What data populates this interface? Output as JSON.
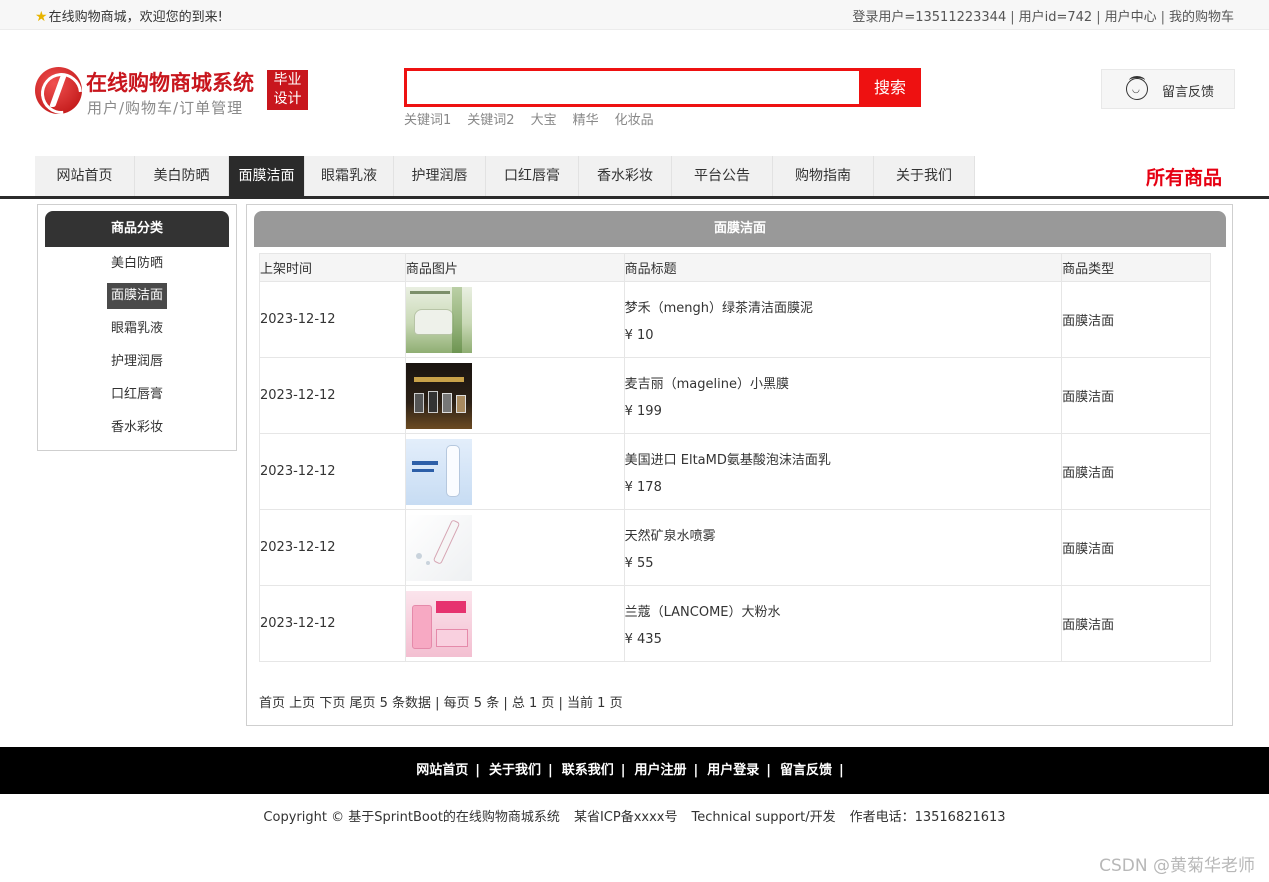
{
  "topbar": {
    "welcome": "在线购物商城，欢迎您的到来!",
    "login_user": "登录用户=13511223344",
    "user_id": "用户id=742",
    "user_center": "用户中心",
    "cart": "我的购物车"
  },
  "header": {
    "site_title": "在线购物商城系统",
    "site_subtitle": "用户/购物车/订单管理",
    "badge_line1": "毕业",
    "badge_line2": "设计",
    "search_placeholder": "",
    "search_button": "搜索",
    "hot_keywords": [
      "关键词1",
      "关键词2",
      "大宝",
      "精华",
      "化妆品"
    ],
    "feedback": "留言反馈"
  },
  "nav": {
    "items": [
      "网站首页",
      "美白防晒",
      "面膜洁面",
      "眼霜乳液",
      "护理润唇",
      "口红唇膏",
      "香水彩妆",
      "平台公告",
      "购物指南",
      "关于我们"
    ],
    "active_index": 2,
    "all_products": "所有商品"
  },
  "sidebar": {
    "title": "商品分类",
    "items": [
      "美白防晒",
      "面膜洁面",
      "眼霜乳液",
      "护理润唇",
      "口红唇膏",
      "香水彩妆"
    ],
    "active_index": 1
  },
  "main": {
    "title": "面膜洁面",
    "columns": [
      "上架时间",
      "商品图片",
      "商品标题",
      "商品类型"
    ],
    "rows": [
      {
        "date": "2023-12-12",
        "title": "梦禾（mengh）绿茶清洁面膜泥",
        "price": "¥ 10",
        "type": "面膜洁面"
      },
      {
        "date": "2023-12-12",
        "title": "麦吉丽（mageline）小黑膜",
        "price": "¥ 199",
        "type": "面膜洁面"
      },
      {
        "date": "2023-12-12",
        "title": "美国进口 EltaMD氨基酸泡沫洁面乳",
        "price": "¥ 178",
        "type": "面膜洁面"
      },
      {
        "date": "2023-12-12",
        "title": "天然矿泉水喷雾",
        "price": "¥ 55",
        "type": "面膜洁面"
      },
      {
        "date": "2023-12-12",
        "title": "兰蔻（LANCOME）大粉水",
        "price": "¥ 435",
        "type": "面膜洁面"
      }
    ],
    "pager": {
      "first": "首页",
      "prev": "上页",
      "next": "下页",
      "last": "尾页",
      "summary": "5 条数据 | 每页 5 条 | 总 1 页 | 当前 1 页"
    }
  },
  "footer": {
    "links": [
      "网站首页",
      "关于我们",
      "联系我们",
      "用户注册",
      "用户登录",
      "留言反馈"
    ],
    "copyright": "Copyright © 基于SprintBoot的在线购物商城系统",
    "icp": "某省ICP备xxxx号",
    "support": "Technical support/开发",
    "phone": "作者电话：13516821613"
  },
  "watermark": "CSDN @黄菊华老师"
}
